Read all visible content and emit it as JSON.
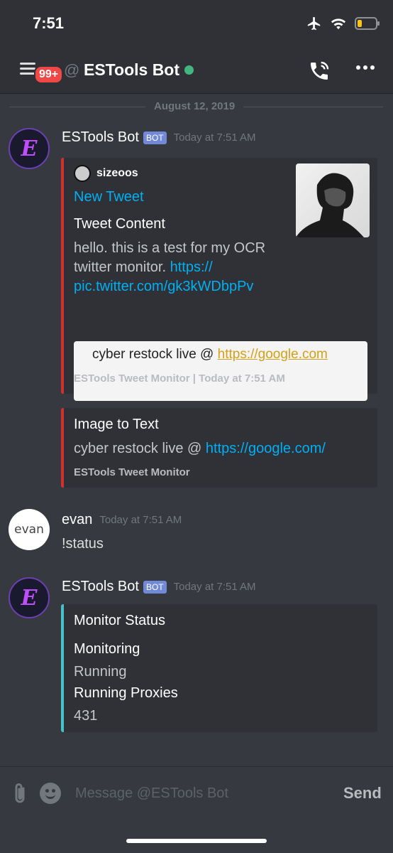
{
  "status_bar": {
    "time": "7:51",
    "battery_level": 0.25,
    "icons": [
      "airplane-icon",
      "wifi-icon",
      "battery-icon"
    ]
  },
  "header": {
    "badge": "99+",
    "at": "@",
    "title": "ESTools Bot",
    "status": "online"
  },
  "date_divider": "August 12, 2019",
  "messages": [
    {
      "author": "ESTools Bot",
      "bot_tag": "BOT",
      "timestamp": "Today at 7:51 AM",
      "embeds": [
        {
          "author_name": "sizeoos",
          "title": "New Tweet",
          "field_name": "Tweet Content",
          "field_value_line1": "hello. this is a test for my OCR",
          "field_value_line2_text": "twitter monitor. ",
          "field_value_link1": "https://",
          "field_value_link2": "pic.twitter.com/gk3kWDbpPv",
          "image_text": "cyber restock live @ ",
          "image_link": "https://google.com",
          "footer": "ESTools Tweet Monitor | Today at 7:51 AM"
        },
        {
          "field_name": "Image to Text",
          "field_value_text": "cyber restock live @ ",
          "field_value_link": "https://google.com/",
          "footer": "ESTools Tweet Monitor"
        }
      ]
    },
    {
      "author": "evan",
      "avatar_text": "evan",
      "timestamp": "Today at 7:51 AM",
      "content": "!status"
    },
    {
      "author": "ESTools Bot",
      "bot_tag": "BOT",
      "timestamp": "Today at 7:51 AM",
      "embeds": [
        {
          "title": "Monitor Status",
          "field1_name": "Monitoring",
          "field1_value": "Running",
          "field2_name": "Running Proxies",
          "field2_value": "431"
        }
      ]
    }
  ],
  "composer": {
    "placeholder": "Message @ESTools Bot",
    "send_label": "Send"
  },
  "colors": {
    "background": "#36393f",
    "embed_red": "#d0312d",
    "embed_cyan": "#47c1ca",
    "link": "#00b0f4",
    "online": "#43b581",
    "badge": "#f04747"
  }
}
